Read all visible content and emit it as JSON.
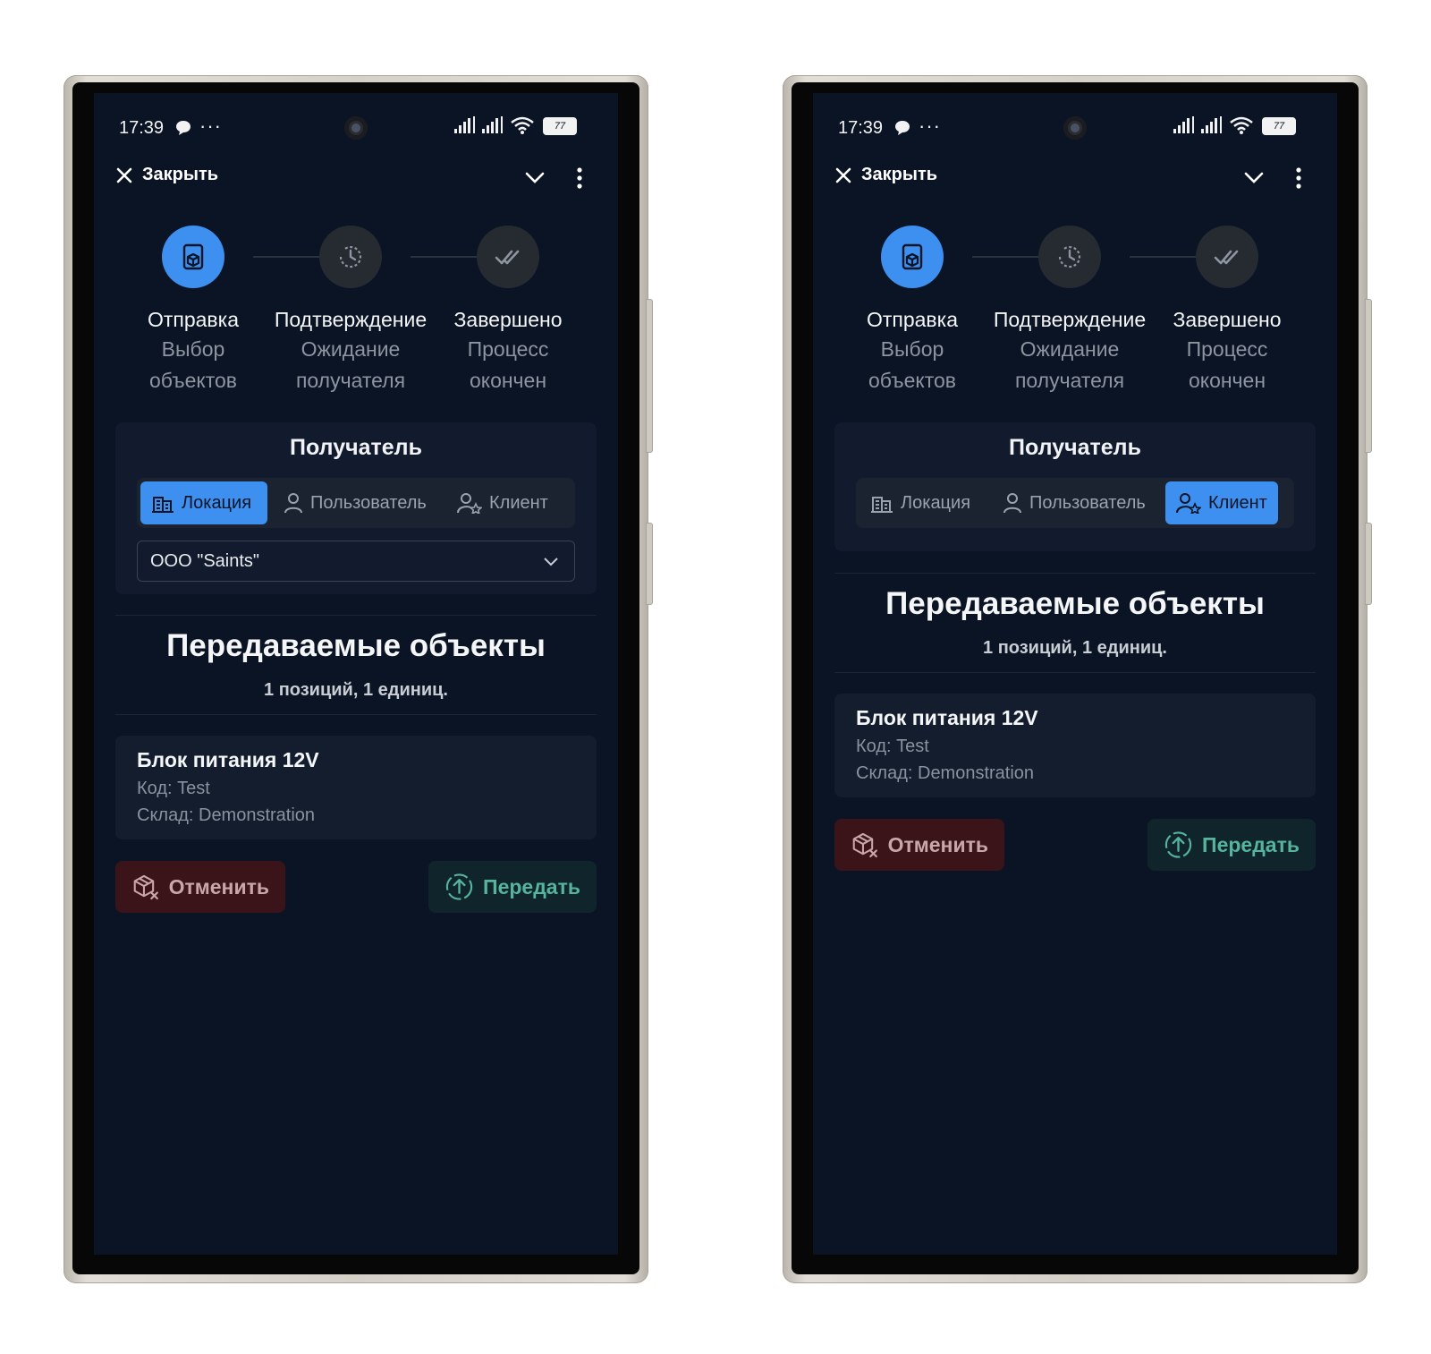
{
  "status_bar": {
    "time": "17:39",
    "dots": "···",
    "battery": "77"
  },
  "topbar": {
    "close_label": "Закрыть"
  },
  "steps": [
    {
      "title": "Отправка",
      "subtitle": "Выбор\nобъектов",
      "state": "active",
      "icon": "package-send-icon"
    },
    {
      "title": "Подтверждение",
      "subtitle": "Ожидание\nполучателя",
      "state": "pending",
      "icon": "clock-history-icon"
    },
    {
      "title": "Завершено",
      "subtitle": "Процесс\nокончен",
      "state": "pending",
      "icon": "double-check-icon"
    }
  ],
  "recipient": {
    "title": "Получатель",
    "tabs": [
      {
        "label": "Локация",
        "icon": "building-icon"
      },
      {
        "label": "Пользователь",
        "icon": "user-icon"
      },
      {
        "label": "Клиент",
        "icon": "user-star-icon"
      }
    ],
    "select_value": "ООО \"Saints\""
  },
  "objects": {
    "title": "Передаваемые объекты",
    "summary": "1 позиций, 1 единиц.",
    "items": [
      {
        "name": "Блок питания 12V",
        "code": "Код: Test",
        "warehouse": "Склад: Demonstration"
      }
    ]
  },
  "actions": {
    "cancel_label": "Отменить",
    "send_label": "Передать"
  },
  "screens": [
    {
      "active_tab": 0,
      "show_select": true
    },
    {
      "active_tab": 2,
      "show_select": false
    }
  ],
  "colors": {
    "accent": "#3d8ff0",
    "background": "#0b1424",
    "cancel": "#3a1419",
    "send": "#10242b",
    "send_text": "#55b49b"
  }
}
